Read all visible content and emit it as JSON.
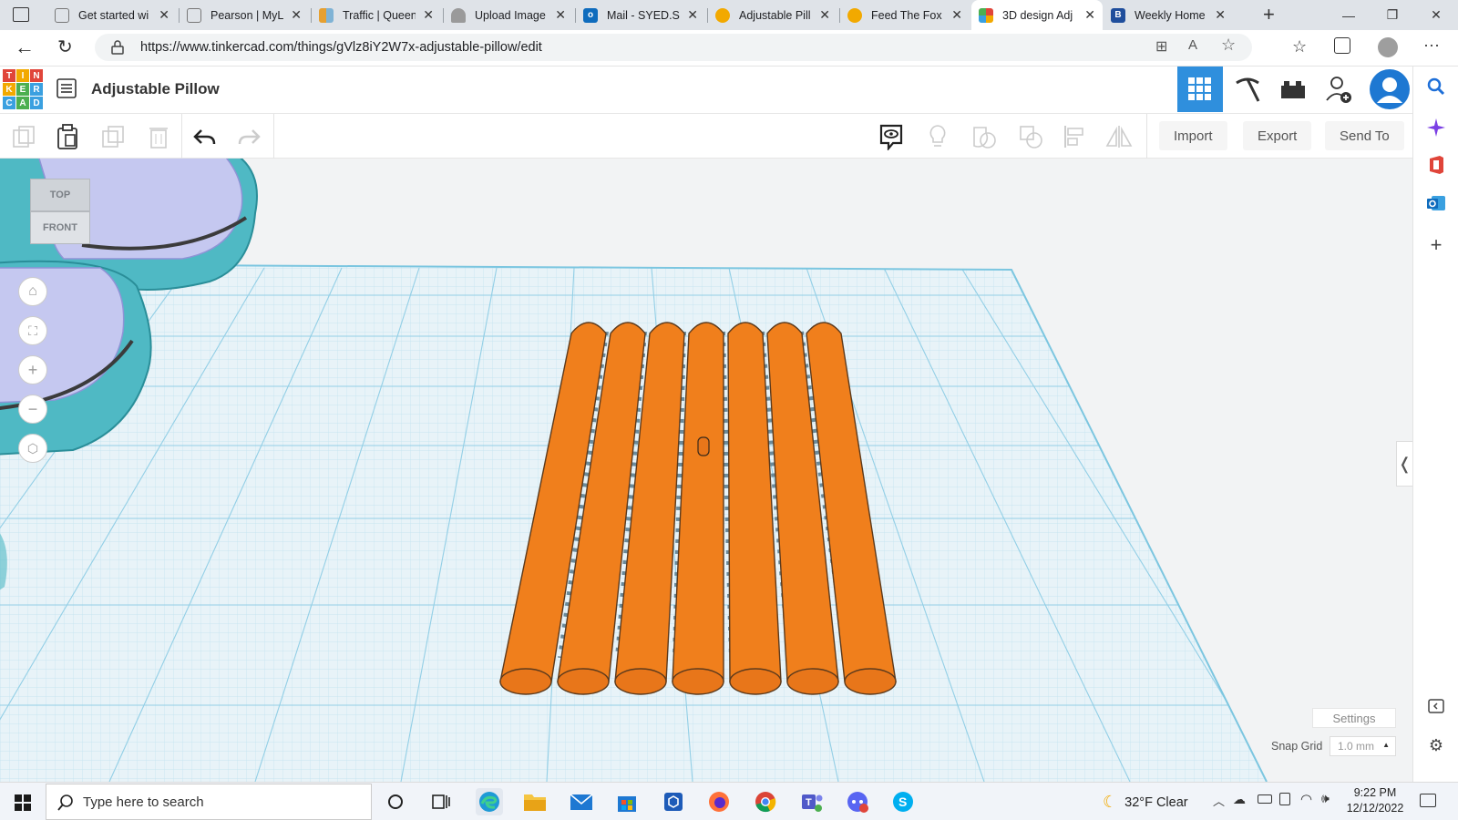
{
  "browser": {
    "tabs": [
      {
        "title": "Get started wi",
        "color": "#7a7a7a"
      },
      {
        "title": "Pearson | MyL",
        "color": "#7a7a7a"
      },
      {
        "title": "Traffic | Queen",
        "color": "#e6a030"
      },
      {
        "title": "Upload Image",
        "color": "#888888"
      },
      {
        "title": "Mail - SYED.SH",
        "color": "#0f6cbd"
      },
      {
        "title": "Adjustable Pill",
        "color": "#f2a900"
      },
      {
        "title": "Feed The Fox c",
        "color": "#f2a900"
      },
      {
        "title": "3D design Adj",
        "color": "#e0453a"
      },
      {
        "title": "Weekly Home",
        "color": "#1f4e9c"
      }
    ],
    "url": "https://www.tinkercad.com/things/gVlz8iY2W7x-adjustable-pillow/edit"
  },
  "tinkercad": {
    "logo_letters": [
      "T",
      "I",
      "N",
      "K",
      "E",
      "R",
      "C",
      "A",
      "D"
    ],
    "design_title": "Adjustable Pillow",
    "toolbar": {
      "import_label": "Import",
      "export_label": "Export",
      "send_to_label": "Send To"
    },
    "viewcube": {
      "top_label": "TOP",
      "front_label": "FRONT"
    },
    "settings_label": "Settings",
    "snap_grid_label": "Snap Grid",
    "snap_grid_value": "1.0 mm",
    "colors": {
      "shape": "#f07f1c",
      "grid_line": "#a8d8ec",
      "grid_bg": "#e8f3f8",
      "teal": "#4fb9c4",
      "lavender": "#c5c8f0"
    }
  },
  "taskbar": {
    "search_placeholder": "Type here to search",
    "weather": "32°F  Clear",
    "time": "9:22 PM",
    "date": "12/12/2022"
  }
}
